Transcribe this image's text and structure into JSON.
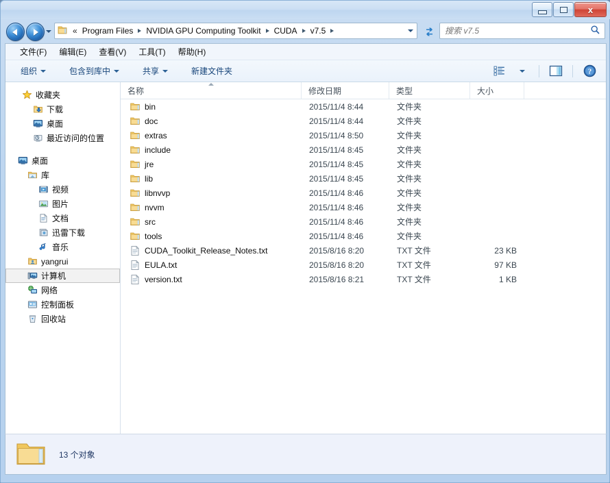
{
  "window": {
    "controls": {
      "minimize": "minimize-button",
      "maximize": "maximize-button",
      "close_label": "x"
    }
  },
  "navbar": {
    "back_tooltip": "back",
    "forward_tooltip": "forward",
    "breadcrumb_overflow": "«",
    "breadcrumbs": [
      "Program Files",
      "NVIDIA GPU Computing Toolkit",
      "CUDA",
      "v7.5"
    ],
    "search": {
      "placeholder": "搜索 v7.5",
      "value": ""
    }
  },
  "menubar": {
    "items": [
      "文件(F)",
      "编辑(E)",
      "查看(V)",
      "工具(T)",
      "帮助(H)"
    ]
  },
  "toolbar": {
    "organize": "组织",
    "include_in_library": "包含到库中",
    "share": "共享",
    "new_folder": "新建文件夹",
    "view_mode": "view-mode",
    "preview_pane": "preview-pane",
    "help": "help"
  },
  "sidebar": {
    "groups": [
      {
        "header": {
          "label": "收藏夹",
          "icon": "star-icon"
        },
        "items": [
          {
            "label": "下载",
            "icon": "downloads-icon",
            "indent": 1,
            "selected": false
          },
          {
            "label": "桌面",
            "icon": "desktop-icon",
            "indent": 1,
            "selected": false
          },
          {
            "label": "最近访问的位置",
            "icon": "recent-places-icon",
            "indent": 1,
            "selected": false
          }
        ]
      },
      {
        "header": {
          "label": "桌面",
          "icon": "desktop-icon"
        },
        "items": [
          {
            "label": "库",
            "icon": "library-icon",
            "indent": 1,
            "selected": false
          },
          {
            "label": "视频",
            "icon": "video-icon",
            "indent": 2,
            "selected": false
          },
          {
            "label": "图片",
            "icon": "pictures-icon",
            "indent": 2,
            "selected": false
          },
          {
            "label": "文档",
            "icon": "documents-icon",
            "indent": 2,
            "selected": false
          },
          {
            "label": "迅雷下载",
            "icon": "thunder-download-icon",
            "indent": 2,
            "selected": false
          },
          {
            "label": "音乐",
            "icon": "music-icon",
            "indent": 2,
            "selected": false
          },
          {
            "label": "yangrui",
            "icon": "user-folder-icon",
            "indent": 1,
            "selected": false
          },
          {
            "label": "计算机",
            "icon": "computer-icon",
            "indent": 1,
            "selected": true
          },
          {
            "label": "网络",
            "icon": "network-icon",
            "indent": 1,
            "selected": false
          },
          {
            "label": "控制面板",
            "icon": "control-panel-icon",
            "indent": 1,
            "selected": false
          },
          {
            "label": "回收站",
            "icon": "recycle-bin-icon",
            "indent": 1,
            "selected": false
          }
        ]
      }
    ]
  },
  "file_list": {
    "columns": [
      {
        "label": "名称",
        "sorted": "asc"
      },
      {
        "label": "修改日期",
        "sorted": ""
      },
      {
        "label": "类型",
        "sorted": ""
      },
      {
        "label": "大小",
        "sorted": ""
      }
    ],
    "rows": [
      {
        "name": "bin",
        "date": "2015/11/4 8:44",
        "type": "文件夹",
        "size": "",
        "icon": "folder-icon"
      },
      {
        "name": "doc",
        "date": "2015/11/4 8:44",
        "type": "文件夹",
        "size": "",
        "icon": "folder-icon"
      },
      {
        "name": "extras",
        "date": "2015/11/4 8:50",
        "type": "文件夹",
        "size": "",
        "icon": "folder-icon"
      },
      {
        "name": "include",
        "date": "2015/11/4 8:45",
        "type": "文件夹",
        "size": "",
        "icon": "folder-icon"
      },
      {
        "name": "jre",
        "date": "2015/11/4 8:45",
        "type": "文件夹",
        "size": "",
        "icon": "folder-icon"
      },
      {
        "name": "lib",
        "date": "2015/11/4 8:45",
        "type": "文件夹",
        "size": "",
        "icon": "folder-icon"
      },
      {
        "name": "libnvvp",
        "date": "2015/11/4 8:46",
        "type": "文件夹",
        "size": "",
        "icon": "folder-icon"
      },
      {
        "name": "nvvm",
        "date": "2015/11/4 8:46",
        "type": "文件夹",
        "size": "",
        "icon": "folder-icon"
      },
      {
        "name": "src",
        "date": "2015/11/4 8:46",
        "type": "文件夹",
        "size": "",
        "icon": "folder-icon"
      },
      {
        "name": "tools",
        "date": "2015/11/4 8:46",
        "type": "文件夹",
        "size": "",
        "icon": "folder-icon"
      },
      {
        "name": "CUDA_Toolkit_Release_Notes.txt",
        "date": "2015/8/16 8:20",
        "type": "TXT 文件",
        "size": "23 KB",
        "icon": "text-file-icon"
      },
      {
        "name": "EULA.txt",
        "date": "2015/8/16 8:20",
        "type": "TXT 文件",
        "size": "97 KB",
        "icon": "text-file-icon"
      },
      {
        "name": "version.txt",
        "date": "2015/8/16 8:21",
        "type": "TXT 文件",
        "size": "1 KB",
        "icon": "text-file-icon"
      }
    ]
  },
  "statusbar": {
    "text": "13 个对象"
  },
  "colors": {
    "frame": "#bcd5ef",
    "close_button": "#cf4436",
    "toolbar_text": "#17457a",
    "status_text": "#203864",
    "folder_yellow": "#f5cf76"
  }
}
